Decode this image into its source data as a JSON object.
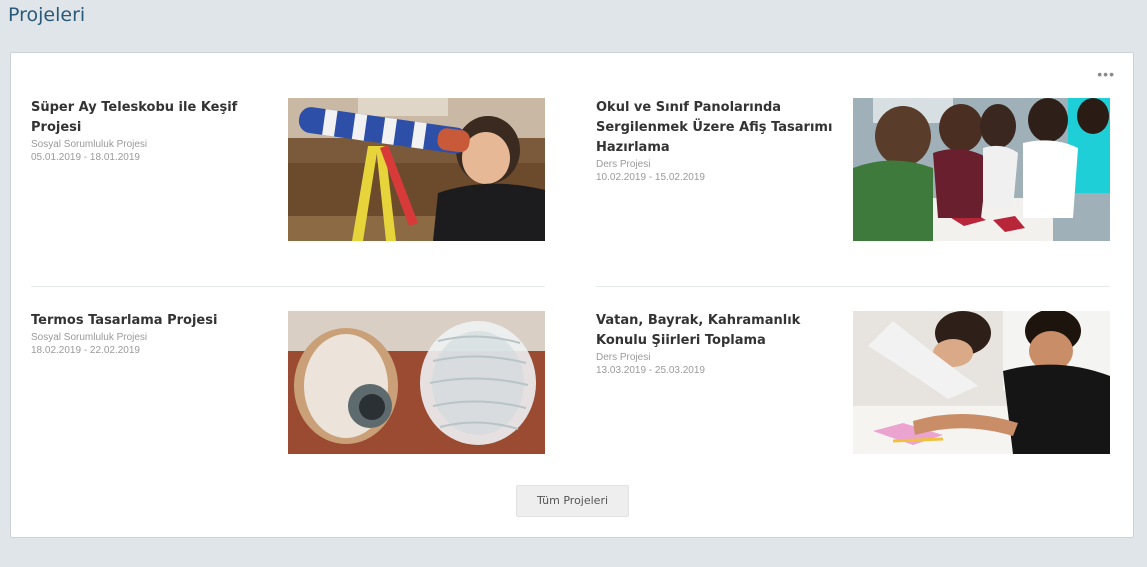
{
  "section": {
    "title": "Projeleri"
  },
  "menu": {
    "more_glyph": "•••"
  },
  "projects": [
    {
      "title": "Süper Ay Teleskobu ile Keşif Projesi",
      "type": "Sosyal Sorumluluk Projesi",
      "dates": "05.01.2019 - 18.01.2019"
    },
    {
      "title": "Okul ve Sınıf Panolarında Sergilenmek Üzere Afiş Tasarımı Hazırlama",
      "type": "Ders Projesi",
      "dates": "10.02.2019 - 15.02.2019"
    },
    {
      "title": "Termos Tasarlama Projesi",
      "type": "Sosyal Sorumluluk Projesi",
      "dates": "18.02.2019 - 22.02.2019"
    },
    {
      "title": "Vatan, Bayrak, Kahramanlık Konulu Şiirleri Toplama",
      "type": "Ders Projesi",
      "dates": "13.03.2019 - 25.03.2019"
    }
  ],
  "footer": {
    "all_projects_label": "Tüm Projeleri"
  }
}
